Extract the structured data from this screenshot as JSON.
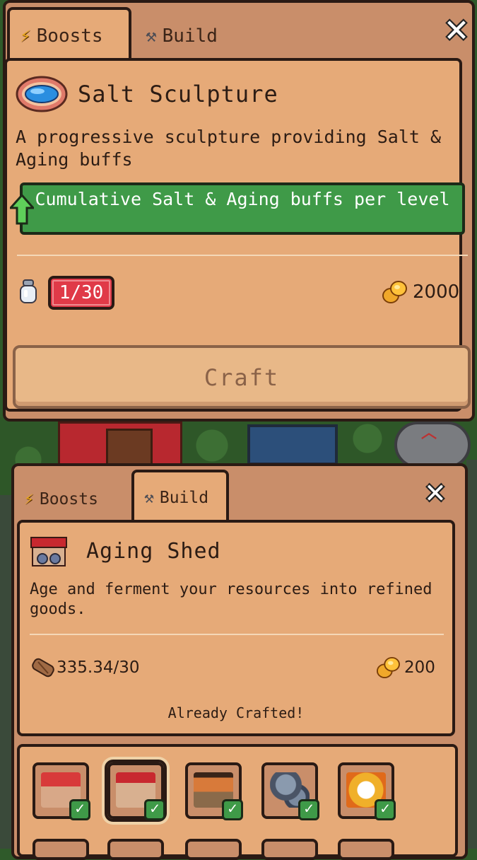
{
  "panel_top": {
    "tabs": [
      {
        "label": "Boosts",
        "icon": "lightning-icon",
        "active": true
      },
      {
        "label": "Build",
        "icon": "hammer-icon",
        "active": false
      }
    ],
    "close_icon": "close-icon",
    "item_title": "Salt Sculpture",
    "item_icon": "salt-sculpture-icon",
    "description": "A progressive sculpture providing Salt & Aging buffs",
    "banner_text": "Cumulative Salt & Aging buffs per level",
    "level_badge": "1/30",
    "price": "2000",
    "craft_label": "Craft"
  },
  "panel_bottom": {
    "tabs": [
      {
        "label": "Boosts",
        "icon": "lightning-icon",
        "active": false
      },
      {
        "label": "Build",
        "icon": "hammer-icon",
        "active": true
      }
    ],
    "close_icon": "close-icon",
    "item_title": "Aging Shed",
    "item_icon": "aging-shed-icon",
    "description": "Age and ferment your resources into refined goods.",
    "resource_amount": "335.34/30",
    "price": "200",
    "status_text": "Already Crafted!"
  },
  "build_grid": [
    {
      "name": "red-building",
      "crafted": true,
      "selected": false
    },
    {
      "name": "aging-shed",
      "crafted": true,
      "selected": true
    },
    {
      "name": "wood-shop",
      "crafted": true,
      "selected": false
    },
    {
      "name": "metal-barrel",
      "crafted": true,
      "selected": false
    },
    {
      "name": "chicken-coop",
      "crafted": true,
      "selected": false
    }
  ],
  "colors": {
    "panel": "#c98e6a",
    "panel_inner": "#e6aa78",
    "banner_green": "#3f9a48",
    "badge_red": "#e03a48",
    "outline": "#2a1a14"
  }
}
